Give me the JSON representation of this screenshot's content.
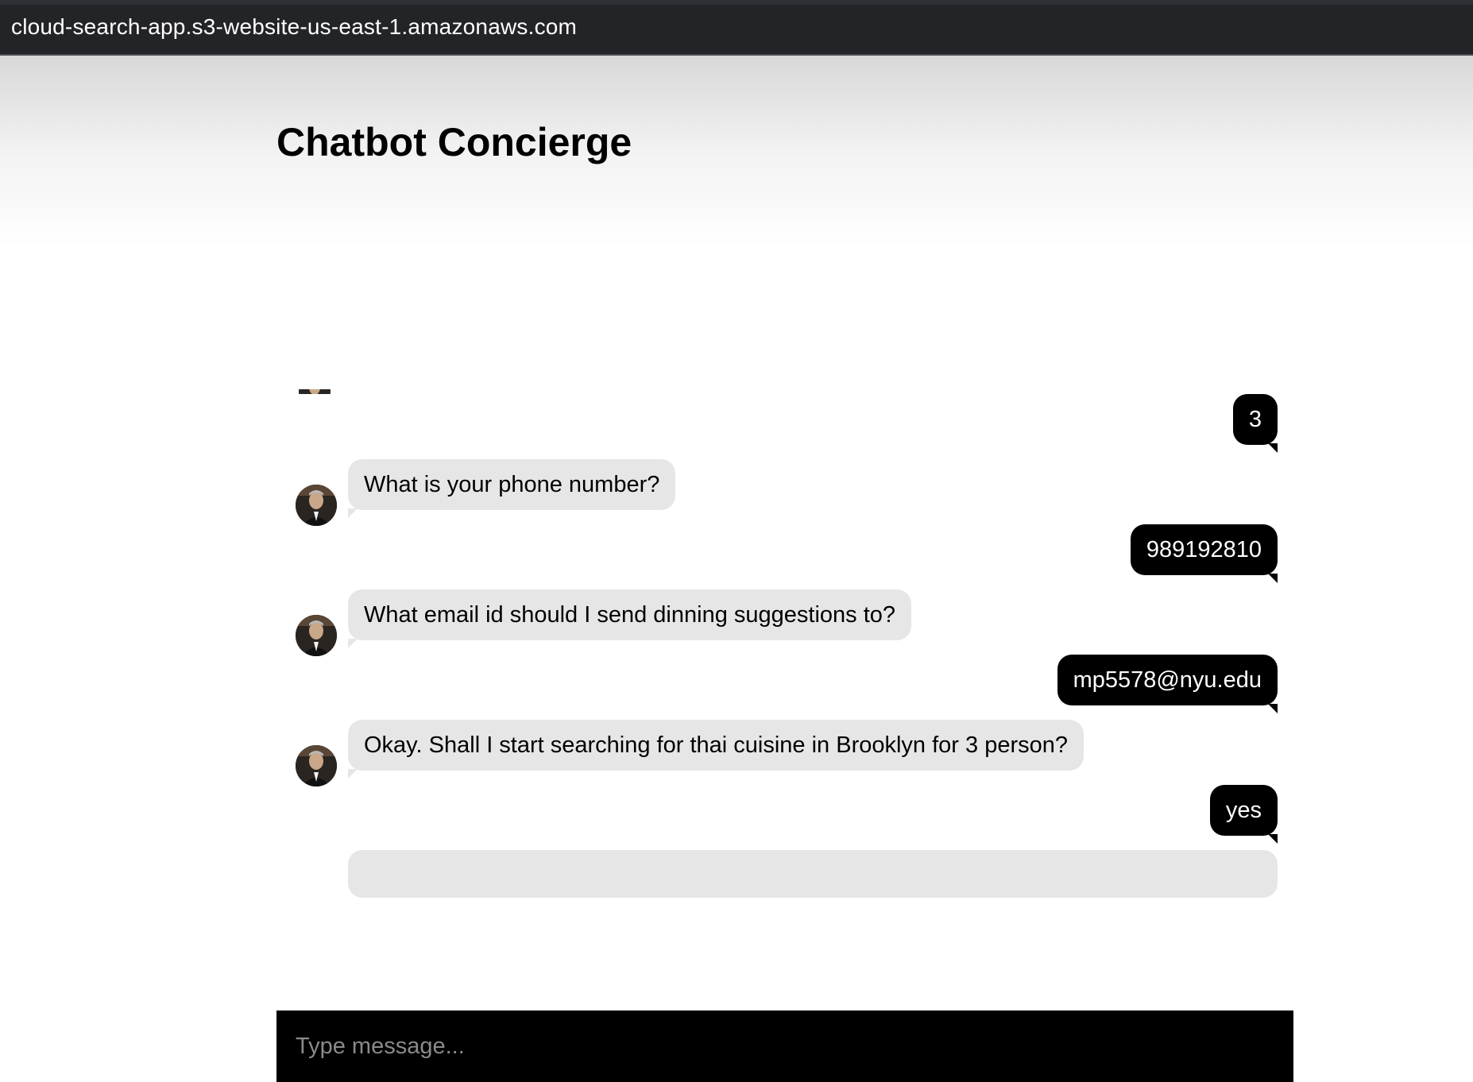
{
  "browser": {
    "url": "cloud-search-app.s3-website-us-east-1.amazonaws.com"
  },
  "page": {
    "title": "Chatbot Concierge"
  },
  "messages": [
    {
      "from": "user",
      "text": "3"
    },
    {
      "from": "bot",
      "text": "What is your phone number?"
    },
    {
      "from": "user",
      "text": "989192810"
    },
    {
      "from": "bot",
      "text": "What email id should I send dinning suggestions to?"
    },
    {
      "from": "user",
      "text": "mp5578@nyu.edu"
    },
    {
      "from": "bot",
      "text": "Okay. Shall I start searching for thai cuisine in Brooklyn for 3 person?"
    },
    {
      "from": "user",
      "text": "yes"
    }
  ],
  "composer": {
    "placeholder": "Type message..."
  },
  "colors": {
    "user_bubble": "#000000",
    "bot_bubble": "#e6e6e6",
    "input_bar": "#000000",
    "browser_bar": "#232428"
  },
  "icons": {
    "avatar": "bot-avatar-icon"
  }
}
